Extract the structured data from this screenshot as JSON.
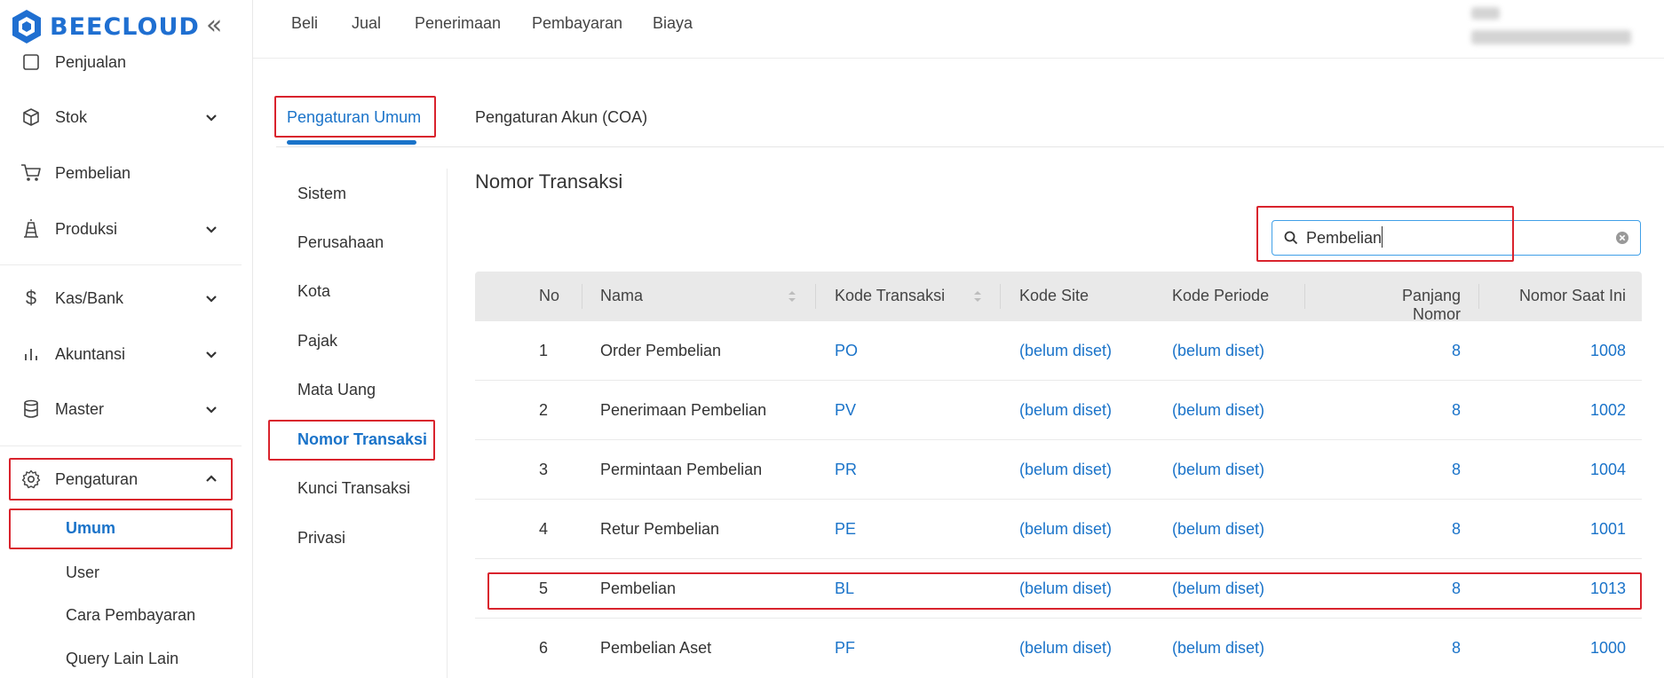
{
  "app": {
    "brand": "BEECLOUD"
  },
  "sidebar": {
    "items": [
      {
        "label": "Penjualan",
        "icon": "document-icon"
      },
      {
        "label": "Stok",
        "icon": "box-icon"
      },
      {
        "label": "Pembelian",
        "icon": "cart-icon"
      },
      {
        "label": "Produksi",
        "icon": "factory-icon"
      },
      {
        "label": "Kas/Bank",
        "icon": "dollar-icon"
      },
      {
        "label": "Akuntansi",
        "icon": "bar-chart-icon"
      },
      {
        "label": "Master",
        "icon": "database-icon"
      },
      {
        "label": "Pengaturan",
        "icon": "gear-icon"
      }
    ],
    "subitems": [
      {
        "label": "Umum"
      },
      {
        "label": "User"
      },
      {
        "label": "Cara Pembayaran"
      },
      {
        "label": "Query Lain Lain"
      }
    ]
  },
  "topbar": {
    "menu": [
      "Beli",
      "Jual",
      "Penerimaan",
      "Pembayaran",
      "Biaya"
    ]
  },
  "tabs": [
    {
      "label": "Pengaturan Umum"
    },
    {
      "label": "Pengaturan Akun (COA)"
    }
  ],
  "settings_menu": [
    "Sistem",
    "Perusahaan",
    "Kota",
    "Pajak",
    "Mata Uang",
    "Nomor Transaksi",
    "Kunci Transaksi",
    "Privasi"
  ],
  "content": {
    "title": "Nomor Transaksi",
    "search": {
      "value": "Pembelian"
    }
  },
  "table": {
    "columns": [
      "No",
      "Nama",
      "Kode Transaksi",
      "Kode Site",
      "Kode Periode",
      "Panjang Nomor",
      "Nomor Saat Ini"
    ],
    "rows": [
      {
        "no": "1",
        "nama": "Order Pembelian",
        "kode": "PO",
        "site": "(belum diset)",
        "periode": "(belum diset)",
        "panjang": "8",
        "nomor": "1008"
      },
      {
        "no": "2",
        "nama": "Penerimaan Pembelian",
        "kode": "PV",
        "site": "(belum diset)",
        "periode": "(belum diset)",
        "panjang": "8",
        "nomor": "1002"
      },
      {
        "no": "3",
        "nama": "Permintaan Pembelian",
        "kode": "PR",
        "site": "(belum diset)",
        "periode": "(belum diset)",
        "panjang": "8",
        "nomor": "1004"
      },
      {
        "no": "4",
        "nama": "Retur Pembelian",
        "kode": "PE",
        "site": "(belum diset)",
        "periode": "(belum diset)",
        "panjang": "8",
        "nomor": "1001"
      },
      {
        "no": "5",
        "nama": "Pembelian",
        "kode": "BL",
        "site": "(belum diset)",
        "periode": "(belum diset)",
        "panjang": "8",
        "nomor": "1013"
      },
      {
        "no": "6",
        "nama": "Pembelian Aset",
        "kode": "PF",
        "site": "(belum diset)",
        "periode": "(belum diset)",
        "panjang": "8",
        "nomor": "1000"
      }
    ]
  },
  "colors": {
    "accent": "#1a73c9",
    "highlight": "#d9232d",
    "header_bg": "#e9e9e9"
  }
}
